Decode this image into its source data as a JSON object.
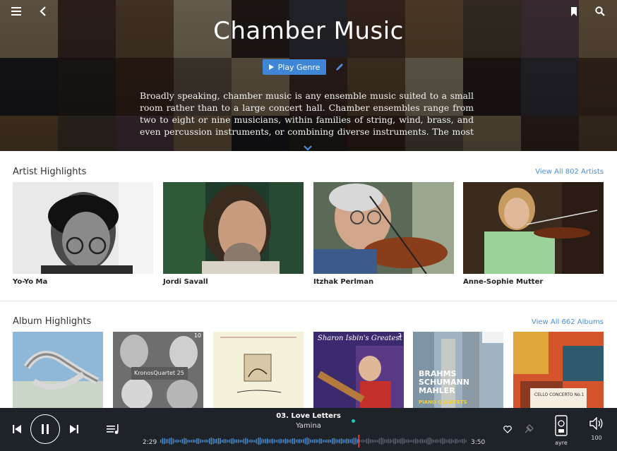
{
  "header": {
    "title": "Chamber Music",
    "play_label": "Play Genre",
    "description": "Broadly speaking, chamber music is any ensemble music suited to a small room rather than to a large concert hall. Chamber ensembles range from two to eight or nine musicians, within families of string, wind, brass, and even percussion instruments, or combining diverse instruments. The most characteristic form is",
    "icons": [
      "menu-icon",
      "back-icon",
      "bookmark-icon",
      "search-icon",
      "edit-icon",
      "chevron-down-icon"
    ]
  },
  "artists": {
    "title": "Artist Highlights",
    "view_all": "View All 802 Artists",
    "items": [
      {
        "name": "Yo-Yo Ma"
      },
      {
        "name": "Jordi Savall"
      },
      {
        "name": "Itzhak Perlman"
      },
      {
        "name": "Anne-Sophie Mutter"
      }
    ]
  },
  "albums": {
    "title": "Album Highlights",
    "view_all": "View All 662 Albums",
    "items": [
      {
        "badge": ""
      },
      {
        "badge": "10",
        "cover_text": "KronosQuartet 25"
      },
      {
        "badge": ""
      },
      {
        "badge": "2",
        "cover_text": "Sharon Isbin's Greatest Hits"
      },
      {
        "badge": "",
        "cover_text": "BRAHMS SCHUMANN MAHLER",
        "cover_subtext": "PIANO QUARTETS"
      },
      {
        "badge": "",
        "cover_text": "CELLO CONCERTO No.1"
      }
    ]
  },
  "player": {
    "track": "03. Love Letters",
    "artist": "Yamina",
    "elapsed": "2:29",
    "duration": "3:50",
    "progress": 0.645,
    "device": "ayre",
    "volume": "100",
    "icons": [
      "previous-icon",
      "pause-icon",
      "next-icon",
      "queue-icon",
      "heart-icon",
      "radio-icon",
      "device-icon",
      "volume-icon"
    ],
    "accent": "#27c4b5"
  }
}
